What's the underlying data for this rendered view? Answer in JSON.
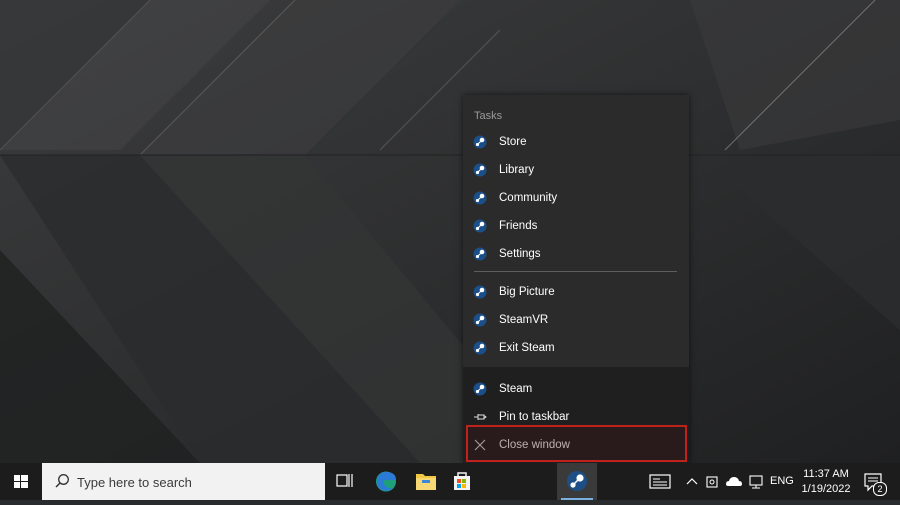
{
  "jumplist": {
    "header": "Tasks",
    "tasks": [
      {
        "label": "Store",
        "icon": "steam-icon"
      },
      {
        "label": "Library",
        "icon": "steam-icon"
      },
      {
        "label": "Community",
        "icon": "steam-icon"
      },
      {
        "label": "Friends",
        "icon": "steam-icon"
      },
      {
        "label": "Settings",
        "icon": "steam-icon"
      },
      {
        "label": "Big Picture",
        "icon": "steam-icon"
      },
      {
        "label": "SteamVR",
        "icon": "steam-icon"
      },
      {
        "label": "Exit Steam",
        "icon": "steam-icon"
      }
    ],
    "app_label": "Steam",
    "pin_label": "Pin to taskbar",
    "close_label": "Close window",
    "highlight_color": "#c0211b"
  },
  "taskbar": {
    "search_placeholder": "Type here to search",
    "language": "ENG",
    "time": "11:37 AM",
    "date": "1/19/2022",
    "notification_count": "2",
    "accent": "#7ab0e0"
  }
}
